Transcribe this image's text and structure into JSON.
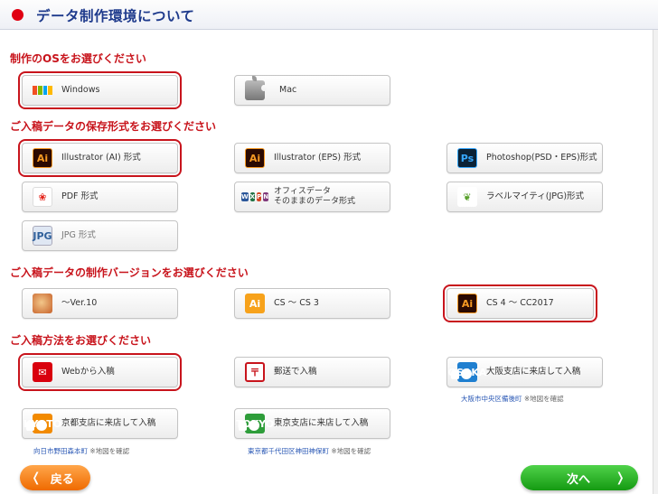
{
  "header": {
    "title": "データ制作環境について"
  },
  "sections": {
    "os": "制作のOSをお選びください",
    "format": "ご入稿データの保存形式をお選びください",
    "version": "ご入稿データの制作バージョンをお選びください",
    "method": "ご入稿方法をお選びください"
  },
  "os_options": [
    {
      "label": "Windows",
      "icon": "windows-logo-icon",
      "selected": true
    },
    {
      "label": "Mac",
      "icon": "apple-logo-icon",
      "selected": false
    }
  ],
  "format_options": [
    {
      "label": "Illustrator (AI) 形式",
      "icon_text": "Ai",
      "selected": true
    },
    {
      "label": "Illustrator (EPS) 形式",
      "icon_text": "Ai",
      "selected": false
    },
    {
      "label": "Photoshop(PSD・EPS)形式",
      "icon_text": "Ps",
      "selected": false
    },
    {
      "label": "PDF 形式",
      "icon": "pdf-icon",
      "selected": false
    },
    {
      "label_line1": "オフィスデータ",
      "label_line2": "そのままのデータ形式",
      "icon": "office-icon",
      "selected": false
    },
    {
      "label": "ラベルマイティ(JPG)形式",
      "icon": "leaf-icon",
      "selected": false
    },
    {
      "label": "JPG 形式",
      "icon": "jpg-icon",
      "selected": false,
      "disabled": true
    }
  ],
  "version_options": [
    {
      "label": "～Ver.10",
      "icon": "legacy-illustrator-icon",
      "selected": false
    },
    {
      "label": "CS ～ CS 3",
      "icon_text": "Ai",
      "selected": false
    },
    {
      "label": "CS 4 ～ CC2017",
      "icon_text": "Ai",
      "selected": true
    }
  ],
  "method_options": [
    {
      "label": "Webから入稿",
      "icon": "web-upload-icon",
      "selected": true
    },
    {
      "label": "郵送で入稿",
      "icon": "mail-icon",
      "selected": false
    },
    {
      "label": "大阪支店に来店して入稿",
      "icon_text": "OSAKA",
      "selected": false
    },
    {
      "label": "京都支店に来店して入稿",
      "icon_text": "KYOTO",
      "selected": false
    },
    {
      "label": "東京支店に来店して入稿",
      "icon_text": "TOKYO",
      "selected": false
    }
  ],
  "store_links": {
    "osaka": {
      "address": "大阪市中央区備後町",
      "map": "※地図を確認"
    },
    "kyoto": {
      "address": "向日市野田森本町",
      "map": "※地図を確認"
    },
    "tokyo": {
      "address": "東京都千代田区神田神保町",
      "map": "※地図を確認"
    }
  },
  "nav": {
    "back": "戻る",
    "next": "次へ"
  },
  "colors": {
    "accent_red": "#c8141c",
    "title_blue": "#1e3a8c",
    "back_orange": "#ef6a00",
    "next_green": "#159a12",
    "osaka_blue": "#1f7fd0",
    "kyoto_orange": "#f28a00",
    "tokyo_green": "#2e9d3a"
  }
}
